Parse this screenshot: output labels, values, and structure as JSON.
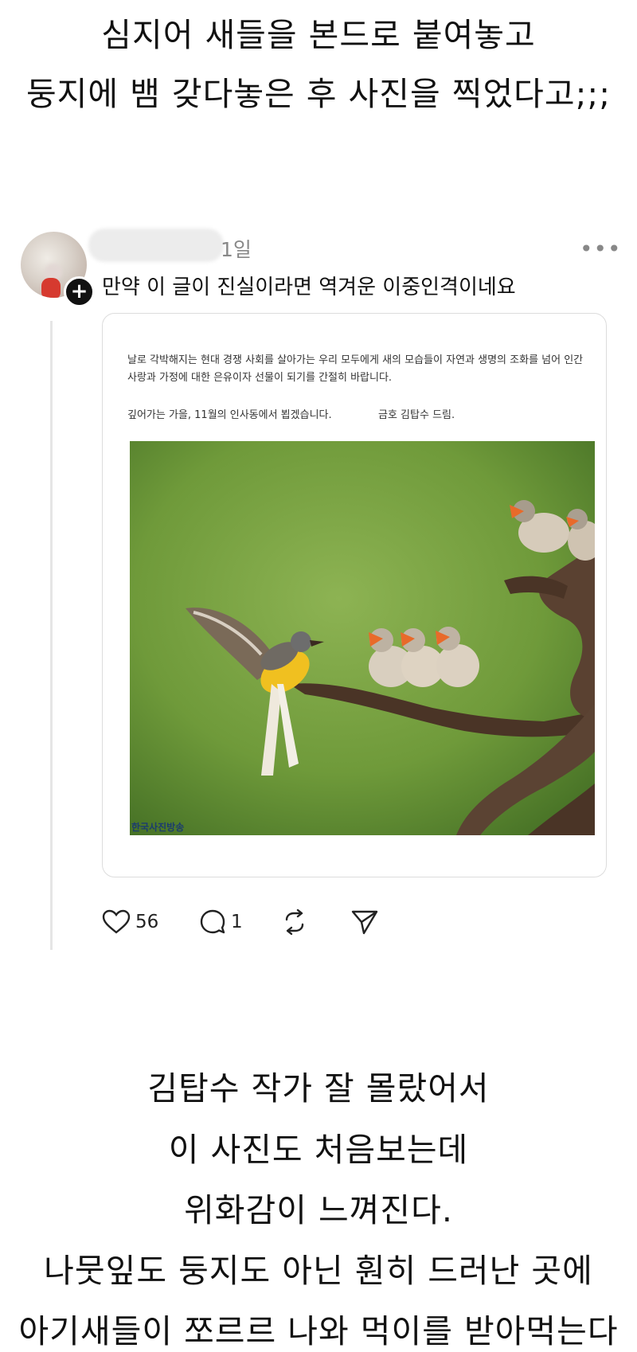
{
  "captions_top": [
    "심지어 새들을 본드로 붙여놓고",
    "둥지에 뱀 갖다놓은 후 사진을 찍었다고;;;"
  ],
  "post": {
    "time": "1일",
    "more": "•••",
    "text": "만약 이 글이 진실이라면 역겨운 이중인격이네요",
    "embed": {
      "line1": "날로 각박해지는 현대 경쟁 사회를 살아가는 우리 모두에게 새의 모습들이 자연과 생명의 조화를 넘어 인간",
      "line2": "사랑과 가정에 대한 은유이자 선물이 되기를 간절히 바랍니다.",
      "line3a": "깊어가는 가을, 11월의 인사동에서 뵙겠습니다.",
      "line3b": "금호 김탑수 드림.",
      "watermark": "한국사진방송"
    },
    "actions": {
      "likes": "56",
      "comments": "1"
    }
  },
  "captions_bottom": [
    "김탑수 작가 잘 몰랐어서",
    "이 사진도 처음보는데",
    "위화감이 느껴진다.",
    "나뭇잎도 둥지도 아닌 훤히 드러난 곳에",
    "아기새들이 쪼르르 나와 먹이를 받아먹는다"
  ],
  "colors": {
    "photo_bg": "#6f9a3a",
    "bird_yellow": "#f0c020",
    "branch": "#4a3426"
  }
}
